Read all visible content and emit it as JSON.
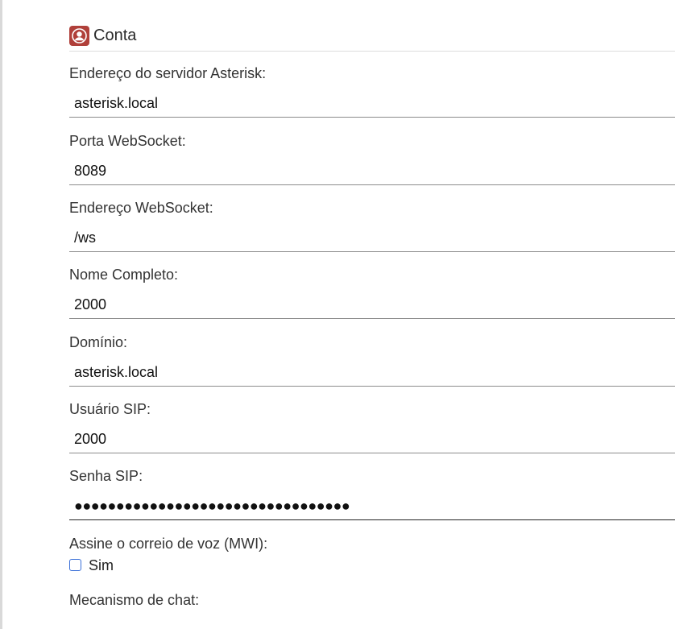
{
  "section": {
    "title": "Conta",
    "icon": "user-circle-icon",
    "icon_color": "#b0403a"
  },
  "fields": [
    {
      "label": "Endereço do servidor Asterisk:",
      "value": "asterisk.local"
    },
    {
      "label": "Porta WebSocket:",
      "value": "8089"
    },
    {
      "label": "Endereço WebSocket:",
      "value": "/ws"
    },
    {
      "label": "Nome Completo:",
      "value": "2000"
    },
    {
      "label": "Domínio:",
      "value": "asterisk.local"
    },
    {
      "label": "Usuário SIP:",
      "value": "2000"
    },
    {
      "label": "Senha SIP:",
      "value": "●●●●●●●●●●●●●●●●●●●●●●●●●●●●●●●●●"
    }
  ],
  "voicemail": {
    "label": "Assine o correio de voz (MWI):",
    "checkbox_label": "Sim",
    "checked": false,
    "checkbox_color": "#3a6fd8"
  },
  "chat": {
    "label": "Mecanismo de chat:"
  }
}
